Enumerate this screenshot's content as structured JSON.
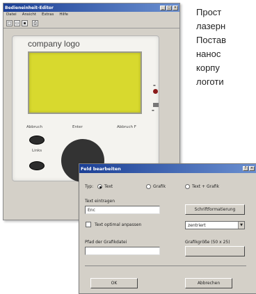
{
  "editor_window": {
    "title": "Bedieneinheit-Editor",
    "menu": [
      "Datei",
      "Ansicht",
      "Extras",
      "Hilfe"
    ],
    "device": {
      "logo_text": "company logo",
      "key_labels": [
        "Abbruch",
        "Enter",
        "Abbruch F"
      ],
      "key_legend": "Links"
    }
  },
  "field_dialog": {
    "title": "Feld bearbeiten",
    "type_label": "Typ:",
    "type_options": [
      "Text",
      "Grafik",
      "Text + Grafik"
    ],
    "selected_type": "Text",
    "text_label": "Text eintragen",
    "text_value": "Enc",
    "font_button": "Schriftformatierung",
    "checkbox_label": "Text optimal anpassen",
    "select_value": "zentriert",
    "path_label": "Pfad der Grafikdatei",
    "size_note": "Grafikgröße (50 x 25)",
    "ok_button": "OK",
    "cancel_button": "Abbrechen"
  },
  "side_text": {
    "lines": [
      "Прост",
      "лазерн",
      "Постав",
      "нанос",
      "корпу",
      "логоти"
    ]
  },
  "colors": {
    "lcd": "#d8d92e",
    "titlebar": "#1b3f95",
    "window": "#d4d0c8"
  }
}
